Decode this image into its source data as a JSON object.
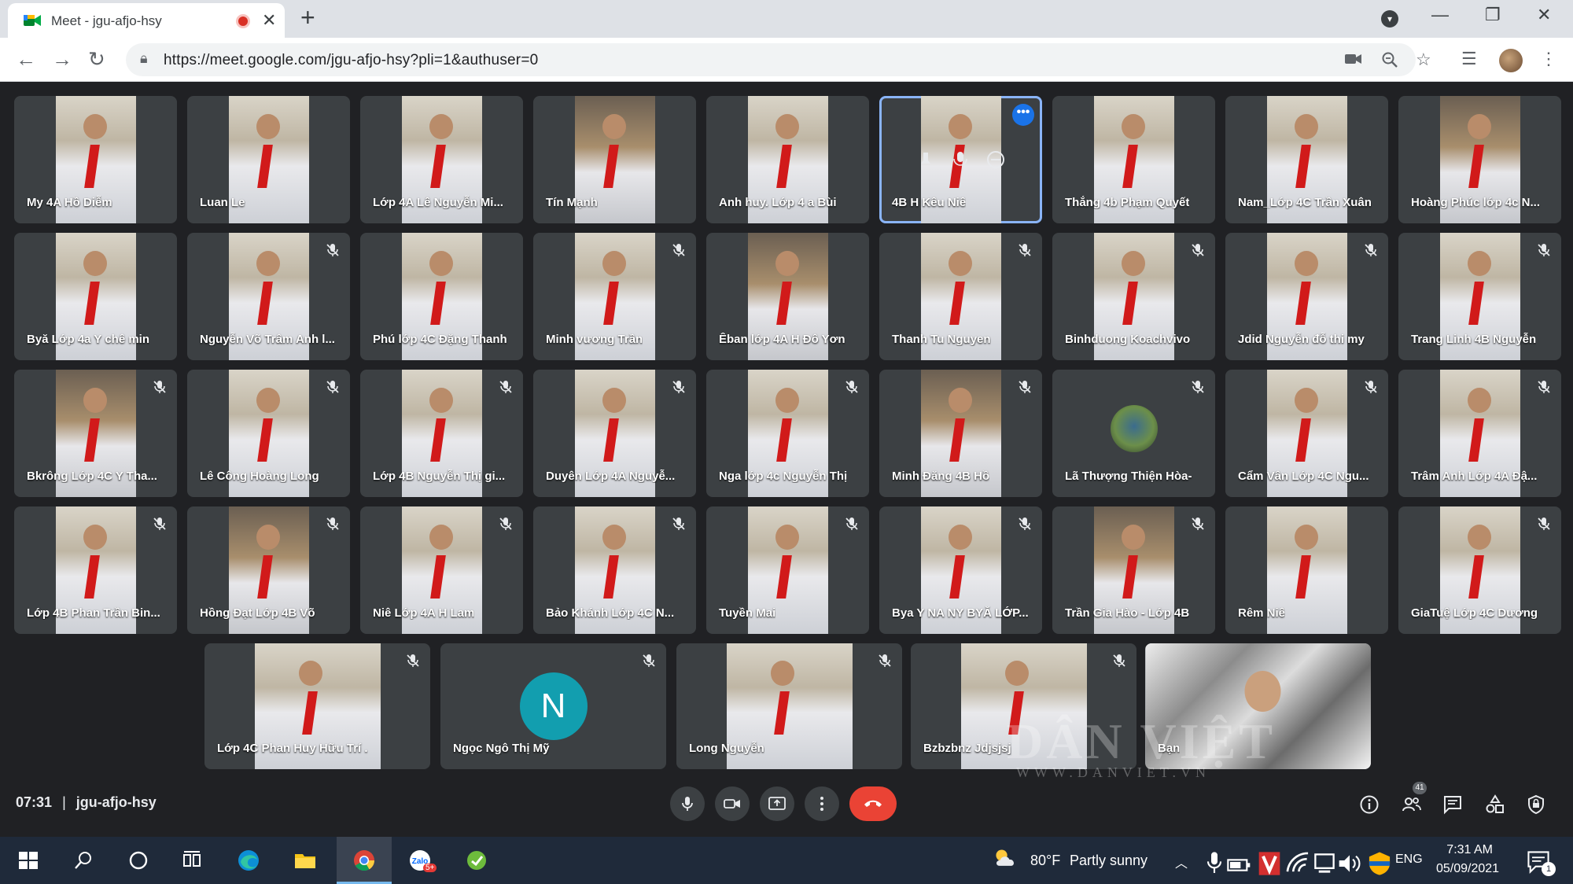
{
  "browser": {
    "tab_title": "Meet - jgu-afjo-hsy",
    "url": "https://meet.google.com/jgu-afjo-hsy?pli=1&authuser=0"
  },
  "participants_grid": [
    {
      "name": "My 4A Hồ Diễm",
      "muted": false
    },
    {
      "name": "Luan Le",
      "muted": false
    },
    {
      "name": "Lớp 4A Lê Nguyễn Mi...",
      "muted": false
    },
    {
      "name": "Tín Mạnh",
      "muted": false
    },
    {
      "name": "Anh huy. Lớp 4 a Bùi",
      "muted": false
    },
    {
      "name": "4B H Kêu Niê",
      "muted": false,
      "selected": true
    },
    {
      "name": "Thắng 4b Phạm Quyết",
      "muted": false
    },
    {
      "name": "Nam_Lớp 4C Trần Xuân",
      "muted": false
    },
    {
      "name": "Hoàng Phúc lớp 4c N...",
      "muted": false
    },
    {
      "name": "Byă Lớp 4a Y chê min",
      "muted": false
    },
    {
      "name": "Nguyễn Võ Trâm Anh l...",
      "muted": true
    },
    {
      "name": "Phú lớp 4C Đặng Thanh",
      "muted": false
    },
    {
      "name": "Minh vương Trần",
      "muted": true
    },
    {
      "name": "Êban lớp 4A H Đô Yơn",
      "muted": false
    },
    {
      "name": "Thanh Tu Nguyen",
      "muted": true
    },
    {
      "name": "Binhduong Koachvivo",
      "muted": true
    },
    {
      "name": "Jdid Nguyễn đỗ thi my",
      "muted": true
    },
    {
      "name": "Trang Linh 4B Nguyễn",
      "muted": true
    },
    {
      "name": "Bkrông Lớp 4C Y Tha...",
      "muted": true
    },
    {
      "name": "Lê Công Hoàng Long",
      "muted": true
    },
    {
      "name": "Lớp 4B Nguyễn Thị gi...",
      "muted": true
    },
    {
      "name": "Duyên Lớp 4A Nguyễ...",
      "muted": true
    },
    {
      "name": "Nga lớp 4c Nguyễn Thị",
      "muted": true
    },
    {
      "name": "Minh Đăng 4B Hồ",
      "muted": true
    },
    {
      "name": "Lã Thượng Thiện Hòa-",
      "muted": true,
      "avatar": "photo"
    },
    {
      "name": "Cẩm Vân Lớp 4C Ngu...",
      "muted": true
    },
    {
      "name": "Trâm Anh Lớp 4A Đậ...",
      "muted": true
    },
    {
      "name": "Lớp 4B Phan Trần Bin...",
      "muted": true
    },
    {
      "name": "Hồng Đạt Lớp 4B Võ",
      "muted": true
    },
    {
      "name": "Niê Lớp 4A H Lam",
      "muted": true
    },
    {
      "name": "Bảo Khánh Lớp 4C N...",
      "muted": true
    },
    {
      "name": "Tuyền Mai",
      "muted": true
    },
    {
      "name": "Bya Y NA NY BYĂ LỚP...",
      "muted": true
    },
    {
      "name": "Trần Gia Hào - Lớp 4B",
      "muted": true
    },
    {
      "name": "Rêm Niê",
      "muted": false
    },
    {
      "name": "GiaTuệ Lớp 4C Dương",
      "muted": true
    }
  ],
  "participants_bottom": [
    {
      "name": "Lớp 4C Phan Huy Hữu Trí .",
      "muted": true
    },
    {
      "name": "Ngọc Ngô Thị Mỹ",
      "muted": true,
      "avatar_letter": "N"
    },
    {
      "name": "Long Nguyễn",
      "muted": true
    },
    {
      "name": "Bzbzbnz Jdjsjsj",
      "muted": true
    },
    {
      "name": "Bạn",
      "muted": false
    }
  ],
  "watermark": {
    "main": "DÂN VIỆT",
    "sub": "WWW.DANVIET.VN"
  },
  "meeting_bar": {
    "time": "07:31",
    "separator": "|",
    "code": "jgu-afjo-hsy",
    "participant_count": "41"
  },
  "taskbar": {
    "temperature": "80°F",
    "weather": "Partly sunny",
    "language": "ENG",
    "time": "7:31 AM",
    "date": "05/09/2021",
    "notification_count": "1",
    "zalo_badge": "5+"
  },
  "colors": {
    "meet_bg": "#202124",
    "tile_bg": "#3c4043",
    "end_call": "#ea4335",
    "selected_outline": "#8ab4f8",
    "avatar_n": "#129eaf"
  }
}
